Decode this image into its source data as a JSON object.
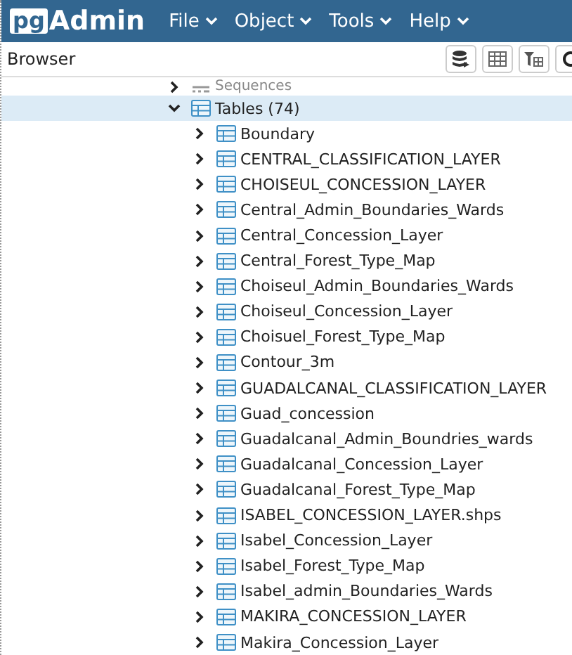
{
  "header": {
    "logo_prefix": "pg",
    "logo_suffix": "Admin",
    "menus": [
      "File",
      "Object",
      "Tools",
      "Help"
    ]
  },
  "browser": {
    "title": "Browser"
  },
  "tree": [
    {
      "label": "Sequences",
      "kind": "sequences",
      "expanded": false,
      "selected": false
    },
    {
      "label": "Tables (74)",
      "kind": "tables",
      "expanded": true,
      "selected": true,
      "children": [
        {
          "label": "Boundary",
          "kind": "table",
          "expanded": false,
          "selected": false
        },
        {
          "label": "CENTRAL_CLASSIFICATION_LAYER",
          "kind": "table",
          "expanded": false,
          "selected": false
        },
        {
          "label": "CHOISEUL_CONCESSION_LAYER",
          "kind": "table",
          "expanded": false,
          "selected": false
        },
        {
          "label": "Central_Admin_Boundaries_Wards",
          "kind": "table",
          "expanded": false,
          "selected": false
        },
        {
          "label": "Central_Concession_Layer",
          "kind": "table",
          "expanded": false,
          "selected": false
        },
        {
          "label": "Central_Forest_Type_Map",
          "kind": "table",
          "expanded": false,
          "selected": false
        },
        {
          "label": "Choiseul_Admin_Boundaries_Wards",
          "kind": "table",
          "expanded": false,
          "selected": false
        },
        {
          "label": "Choiseul_Concession_Layer",
          "kind": "table",
          "expanded": false,
          "selected": false
        },
        {
          "label": "Choisuel_Forest_Type_Map",
          "kind": "table",
          "expanded": false,
          "selected": false
        },
        {
          "label": "Contour_3m",
          "kind": "table",
          "expanded": false,
          "selected": false
        },
        {
          "label": "GUADALCANAL_CLASSIFICATION_LAYER",
          "kind": "table",
          "expanded": false,
          "selected": false
        },
        {
          "label": "Guad_concession",
          "kind": "table",
          "expanded": false,
          "selected": false
        },
        {
          "label": "Guadalcanal_Admin_Boundries_wards",
          "kind": "table",
          "expanded": false,
          "selected": false
        },
        {
          "label": "Guadalcanal_Concession_Layer",
          "kind": "table",
          "expanded": false,
          "selected": false
        },
        {
          "label": "Guadalcanal_Forest_Type_Map",
          "kind": "table",
          "expanded": false,
          "selected": false
        },
        {
          "label": "ISABEL_CONCESSION_LAYER.shps",
          "kind": "table",
          "expanded": false,
          "selected": false
        },
        {
          "label": "Isabel_Concession_Layer",
          "kind": "table",
          "expanded": false,
          "selected": false
        },
        {
          "label": "Isabel_Forest_Type_Map",
          "kind": "table",
          "expanded": false,
          "selected": false
        },
        {
          "label": "Isabel_admin_Boundaries_Wards",
          "kind": "table",
          "expanded": false,
          "selected": false
        },
        {
          "label": "MAKIRA_CONCESSION_LAYER",
          "kind": "table",
          "expanded": false,
          "selected": false
        },
        {
          "label": "Makira_Concession_Layer",
          "kind": "table",
          "expanded": false,
          "selected": false
        }
      ]
    }
  ]
}
